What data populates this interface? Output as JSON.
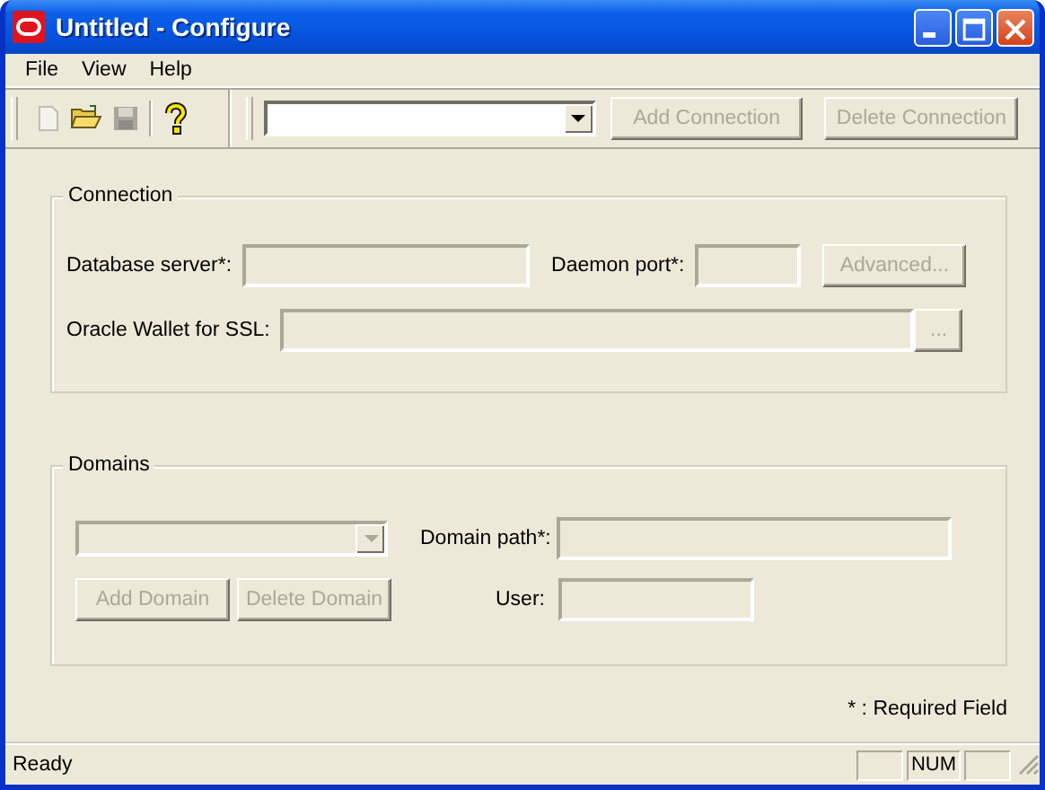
{
  "window": {
    "title": "Untitled - Configure"
  },
  "menu": [
    {
      "label": "File"
    },
    {
      "label": "View"
    },
    {
      "label": "Help"
    }
  ],
  "toolbar": {
    "icons": [
      {
        "kind": "new",
        "disabled": true
      },
      {
        "kind": "open",
        "disabled": false
      },
      {
        "kind": "save",
        "disabled": true
      },
      {
        "kind": "help",
        "disabled": false
      }
    ],
    "connection_combo": {
      "disabled": false
    },
    "buttons": [
      {
        "label": "Add Connection",
        "disabled": true
      },
      {
        "label": "Delete Connection",
        "disabled": true
      }
    ]
  },
  "connection": {
    "title": "Connection",
    "database_server": {
      "label": "Database server*:",
      "disabled": true
    },
    "daemon_port": {
      "label": "Daemon port*:",
      "disabled": true
    },
    "advanced_button": {
      "label": "Advanced...",
      "disabled": true
    },
    "wallet": {
      "label": "Oracle Wallet for SSL:",
      "disabled": true
    },
    "browse_button": {
      "label": "...",
      "disabled": true
    }
  },
  "domains": {
    "title": "Domains",
    "domain_combo": {
      "disabled": true
    },
    "domain_path": {
      "label": "Domain path*:",
      "disabled": true
    },
    "add_button": {
      "label": "Add Domain",
      "disabled": true
    },
    "delete_button": {
      "label": "Delete Domain",
      "disabled": true
    },
    "user": {
      "label": "User:",
      "disabled": true
    }
  },
  "required_note": "* : Required Field",
  "status_bar": {
    "text": "Ready",
    "panels": [
      {
        "kind": "blank"
      },
      {
        "kind": "text",
        "text": "NUM"
      },
      {
        "kind": "blank"
      }
    ]
  }
}
